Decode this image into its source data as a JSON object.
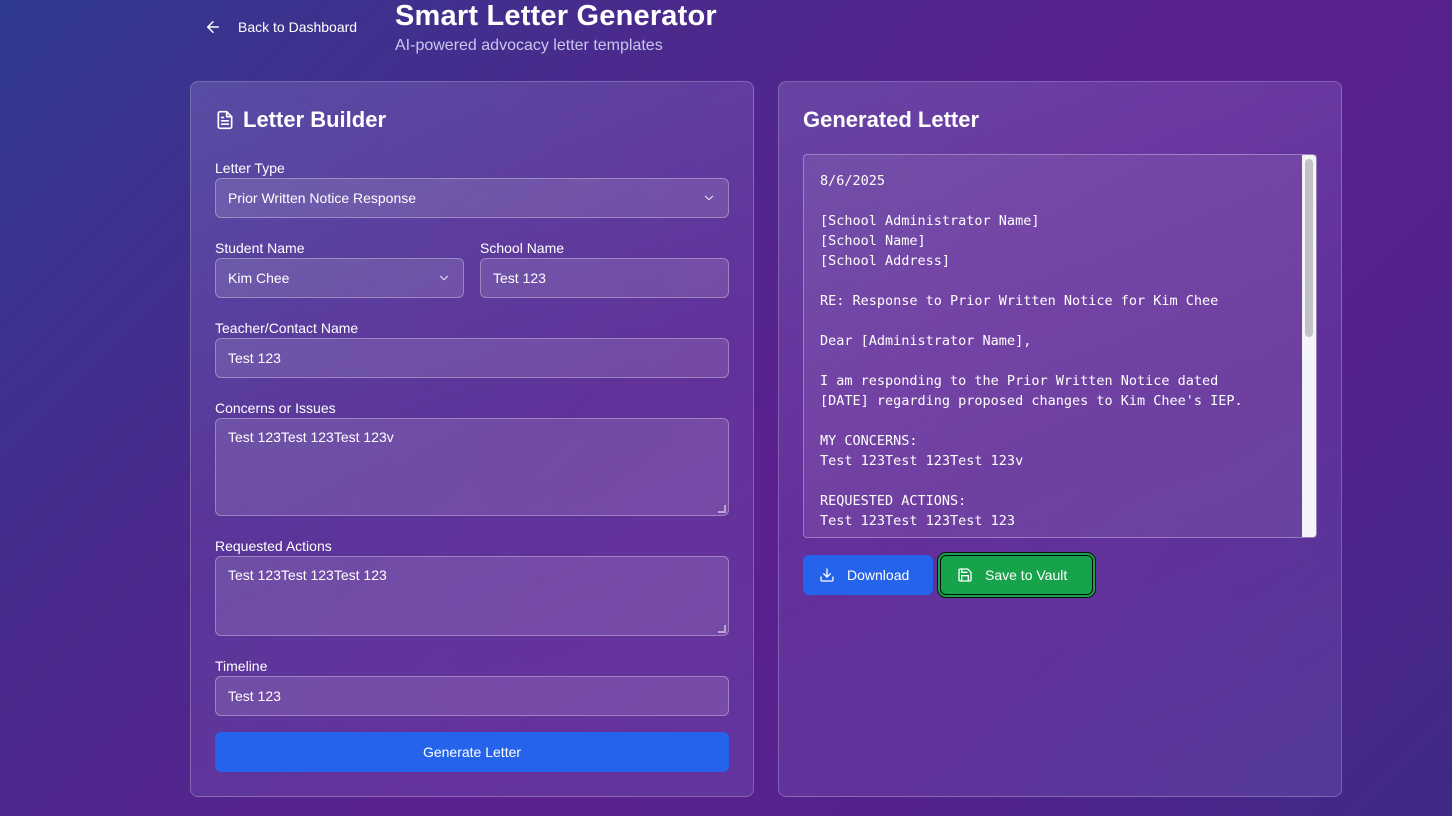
{
  "header": {
    "back_label": "Back to Dashboard",
    "title": "Smart Letter Generator",
    "subtitle": "AI-powered advocacy letter templates"
  },
  "builder": {
    "heading": "Letter Builder",
    "letter_type": {
      "label": "Letter Type",
      "value": "Prior Written Notice Response"
    },
    "student_name": {
      "label": "Student Name",
      "value": "Kim Chee"
    },
    "school_name": {
      "label": "School Name",
      "value": "Test 123"
    },
    "teacher_name": {
      "label": "Teacher/Contact Name",
      "value": "Test 123"
    },
    "concerns": {
      "label": "Concerns or Issues",
      "value": "Test 123Test 123Test 123v"
    },
    "requested_actions": {
      "label": "Requested Actions",
      "value": "Test 123Test 123Test 123"
    },
    "timeline": {
      "label": "Timeline",
      "value": "Test 123"
    },
    "generate_label": "Generate Letter"
  },
  "output": {
    "heading": "Generated Letter",
    "letter_text": "8/6/2025\n\n[School Administrator Name]\n[School Name]\n[School Address]\n\nRE: Response to Prior Written Notice for Kim Chee\n\nDear [Administrator Name],\n\nI am responding to the Prior Written Notice dated\n[DATE] regarding proposed changes to Kim Chee's IEP.\n\nMY CONCERNS:\nTest 123Test 123Test 123v\n\nREQUESTED ACTIONS:\nTest 123Test 123Test 123",
    "download_label": "Download",
    "save_label": "Save to Vault"
  },
  "colors": {
    "primary_button": "#2563eb",
    "save_button": "#16a34a"
  },
  "icons": {
    "back": "arrow-left-icon",
    "builder": "file-text-icon",
    "select": "chevron-down-icon",
    "download": "download-icon",
    "save": "save-icon"
  }
}
